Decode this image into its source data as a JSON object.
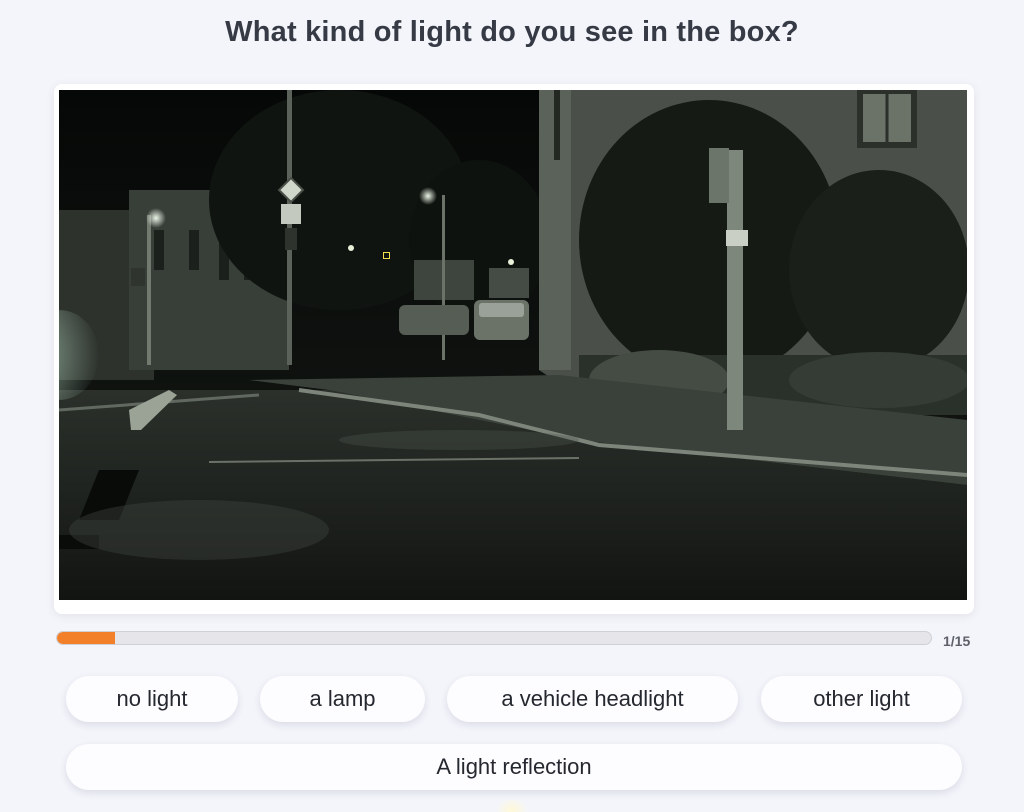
{
  "question": "What kind of light do you see in the box?",
  "progress": {
    "current": 1,
    "total": 15,
    "fraction": 0.0667,
    "label": "1/15",
    "fill_color": "#f27f29"
  },
  "answers": {
    "no_light": "no light",
    "lamp": "a lamp",
    "vehicle_headlight": "a vehicle headlight",
    "other_light": "other light",
    "reflection": "A light reflection"
  },
  "colors": {
    "background": "#f4f5fb",
    "question_text": "#353a45",
    "box_highlight": "#f1e04a"
  }
}
